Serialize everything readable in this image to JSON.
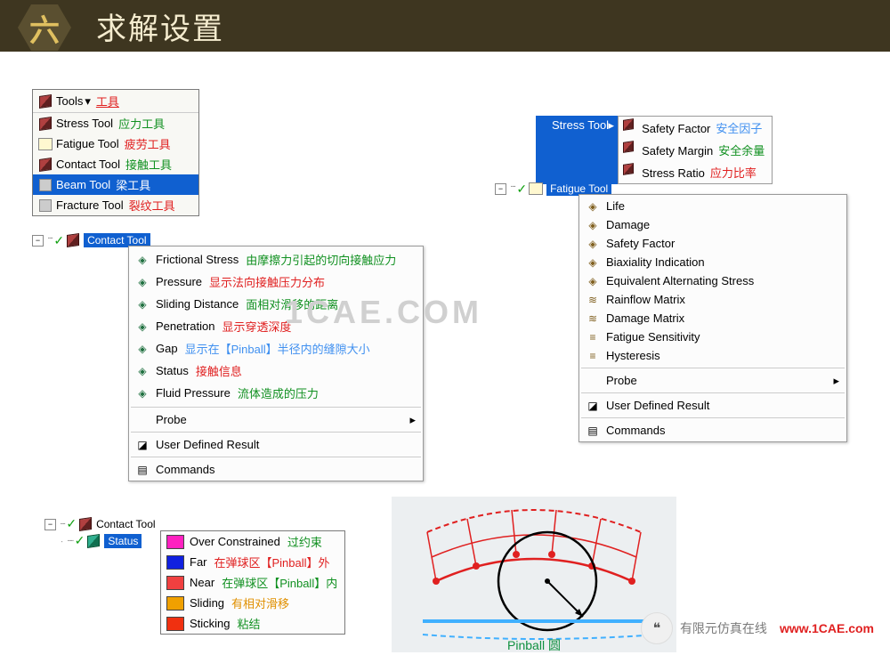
{
  "header": {
    "chapter": "六",
    "title": "求解设置"
  },
  "tools_menu": {
    "button_label": "Tools",
    "button_zh": "工具",
    "items": [
      {
        "en": "Stress Tool",
        "zh": "应力工具",
        "zh_class": "zh-green",
        "icon": "cube"
      },
      {
        "en": "Fatigue Tool",
        "zh": "疲劳工具",
        "zh_class": "zh-red",
        "icon": "yb"
      },
      {
        "en": "Contact Tool",
        "zh": "接触工具",
        "zh_class": "zh-green",
        "icon": "cube"
      },
      {
        "en": "Beam Tool",
        "zh": "梁工具",
        "zh_class": "",
        "icon": "gray",
        "selected": true
      },
      {
        "en": "Fracture Tool",
        "zh": "裂纹工具",
        "zh_class": "zh-red",
        "icon": "gray"
      }
    ]
  },
  "contact_tree": {
    "label": "Contact Tool"
  },
  "contact_ctx": {
    "items": [
      {
        "icon": "◈",
        "en": "Frictional Stress",
        "desc": "由摩擦力引起的切向接触应力",
        "desc_class": "zh-green"
      },
      {
        "icon": "◈",
        "en": "Pressure",
        "desc": "显示法向接触压力分布",
        "desc_class": "zh-red"
      },
      {
        "icon": "◈",
        "en": "Sliding Distance",
        "desc": "面相对滑移的距离",
        "desc_class": "zh-green"
      },
      {
        "icon": "◈",
        "en": "Penetration",
        "desc": "显示穿透深度",
        "desc_class": "zh-red"
      },
      {
        "icon": "◈",
        "en": "Gap",
        "desc": "显示在【Pinball】半径内的缝隙大小",
        "desc_class": "zh-blue"
      },
      {
        "icon": "◈",
        "en": "Status",
        "desc": "接触信息",
        "desc_class": "zh-red"
      },
      {
        "icon": "◈",
        "en": "Fluid Pressure",
        "desc": "流体造成的压力",
        "desc_class": "zh-green"
      }
    ],
    "probe": "Probe",
    "user_defined": "User Defined Result",
    "commands": "Commands"
  },
  "stress_fly": {
    "label": "Stress Tool",
    "sub": [
      {
        "en": "Safety Factor",
        "zh": "安全因子",
        "zh_class": "zh-blue"
      },
      {
        "en": "Safety Margin",
        "zh": "安全余量",
        "zh_class": "zh-green"
      },
      {
        "en": "Stress Ratio",
        "zh": "应力比率",
        "zh_class": "zh-red"
      }
    ]
  },
  "fatigue_tree": {
    "label": "Fatigue Tool"
  },
  "fatigue_ctx": {
    "items": [
      {
        "icon": "◈",
        "en": "Life"
      },
      {
        "icon": "◈",
        "en": "Damage"
      },
      {
        "icon": "◈",
        "en": "Safety Factor"
      },
      {
        "icon": "◈",
        "en": "Biaxiality Indication"
      },
      {
        "icon": "◈",
        "en": "Equivalent Alternating Stress"
      },
      {
        "icon": "≋",
        "en": "Rainflow Matrix"
      },
      {
        "icon": "≋",
        "en": "Damage Matrix"
      },
      {
        "icon": "≡",
        "en": "Fatigue Sensitivity"
      },
      {
        "icon": "≡",
        "en": "Hysteresis"
      }
    ],
    "probe": "Probe",
    "user_defined": "User Defined Result",
    "commands": "Commands"
  },
  "status_tree": {
    "parent": "Contact Tool",
    "child": "Status"
  },
  "status_panel": {
    "items": [
      {
        "color": "#ff20c0",
        "en": "Over Constrained",
        "zh": "过约束",
        "zh_class": "zh-green"
      },
      {
        "color": "#1020e0",
        "en": "Far",
        "zh": "在弹球区【Pinball】外",
        "zh_class": "zh-red"
      },
      {
        "color": "#f04040",
        "en": "Near",
        "zh": "在弹球区【Pinball】内",
        "zh_class": "zh-green"
      },
      {
        "color": "#f0a000",
        "en": "Sliding",
        "zh": "有相对滑移",
        "zh_class": "zh-orange"
      },
      {
        "color": "#f03010",
        "en": "Sticking",
        "zh": "粘结",
        "zh_class": "zh-green"
      }
    ]
  },
  "diagram_label": "Pinball 圆",
  "watermark_text": "1CAE.COM",
  "footer": {
    "wechat": "有限元仿真在线",
    "site": "www.1CAE.com"
  }
}
